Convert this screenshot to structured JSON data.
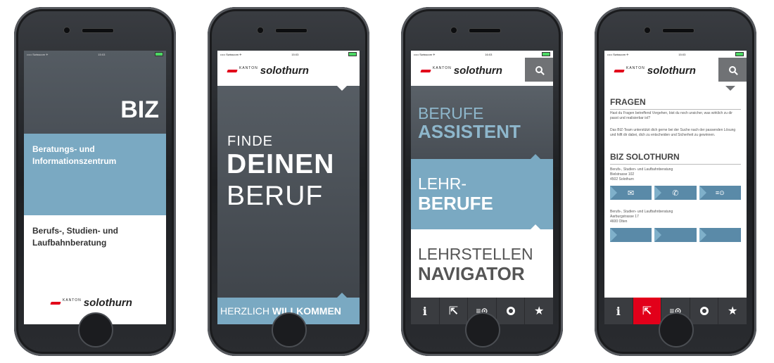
{
  "status": {
    "carrier": "••••• Swisscom ✈",
    "time": "15:03",
    "time_alt": "16:03"
  },
  "logo": {
    "kanton": "KANTON",
    "name": "solothurn"
  },
  "phone1": {
    "title": "BIZ",
    "subtitle": "Beratungs- und Informationszentrum",
    "body": "Berufs-, Studien- und Laufbahnberatung"
  },
  "phone2": {
    "line1": "FINDE",
    "line2": "DEINEN",
    "line3": "BERUF",
    "footer_light": "HERZLICH ",
    "footer_bold": "WILLKOMMEN"
  },
  "phone3": {
    "tiles": [
      {
        "light": "BERUFE",
        "bold": "ASSISTENT"
      },
      {
        "light": "LEHR-",
        "bold": "BERUFE"
      },
      {
        "light": "LEHRSTELLEN",
        "bold": "NAVIGATOR"
      }
    ]
  },
  "phone4": {
    "heading1": "FRAGEN",
    "para1": "Hast du Fragen betreffend Vorgehen, bist du noch unsicher, was wirklich zu dir passt und realisierbar ist?",
    "para2": "Das BIZ-Team unterstützt dich gerne bei der Suche nach der passenden Lösung und hilft dir dabei, dich zu entscheiden und Sicherheit zu gewinnen.",
    "heading2": "BIZ SOLOTHURN",
    "addr1": [
      "Berufs-, Studien- und Laufbahnberatung",
      "Bielstrasse 102",
      "4502 Solothurn"
    ],
    "addr2": [
      "Berufs-, Studien- und Laufbahnberatung",
      "Aarburgstrasse 17",
      "4600 Olten"
    ]
  },
  "tabbar": {
    "icons": [
      "info-icon",
      "share-icon",
      "list-search-icon",
      "gear-icon",
      "star-icon"
    ],
    "glyphs": {
      "info": "i",
      "share": "⇱",
      "list": "≡⊙",
      "star": "★"
    }
  },
  "colors": {
    "accent_red": "#e2001a",
    "slate": "#4e555c",
    "teal": "#7aa9c2",
    "dark_tabbar": "#3a3c40"
  }
}
